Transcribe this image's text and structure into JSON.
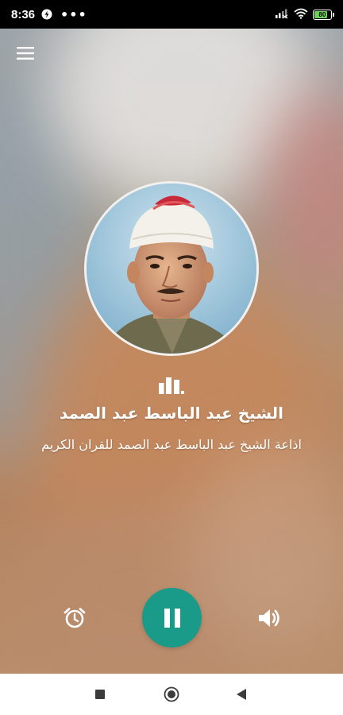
{
  "status_bar": {
    "time": "8:36",
    "dots": "•••",
    "battery_level": "80",
    "battery_fraction": 0.8
  },
  "colors": {
    "accent": "#1a9a88",
    "battery": "#6cd05a"
  },
  "icons": {
    "menu": "hamburger-menu-icon",
    "station": "radio-station-icon",
    "alarm": "alarm-clock-icon",
    "play_pause": "pause-icon",
    "volume": "volume-icon",
    "nav_recents": "square-icon",
    "nav_home": "circle-icon",
    "nav_back": "triangle-back-icon"
  },
  "station": {
    "title": "الشيخ عبد الباسط عبد الصمد",
    "subtitle": "اذاعة الشيخ عبد الباسط عبد الصمد للقران الكريم"
  }
}
